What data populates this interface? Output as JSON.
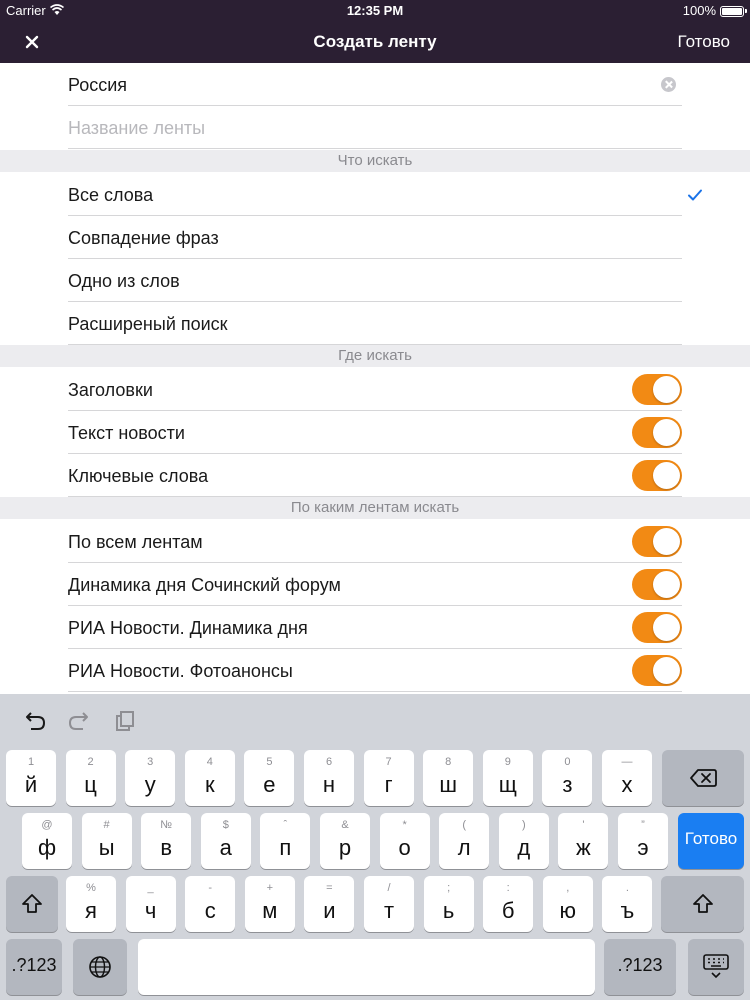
{
  "status_bar": {
    "carrier": "Carrier",
    "time": "12:35 PM",
    "battery": "100%"
  },
  "nav": {
    "close_label": "×",
    "title": "Создать ленту",
    "done_label": "Готово"
  },
  "form": {
    "search_value": "Россия",
    "name_placeholder": "Название ленты"
  },
  "sections": {
    "what": {
      "header": "Что искать",
      "items": [
        "Все слова",
        "Совпадение фраз",
        "Одно из слов",
        "Расширеный поиск"
      ],
      "selected": "Все слова"
    },
    "where": {
      "header": "Где искать",
      "items": [
        {
          "label": "Заголовки",
          "on": true
        },
        {
          "label": "Текст новости",
          "on": true
        },
        {
          "label": "Ключевые слова",
          "on": true
        }
      ]
    },
    "feeds": {
      "header": "По каким лентам искать",
      "items": [
        {
          "label": "По всем лентам",
          "on": true
        },
        {
          "label": "Динамика дня Сочинский форум",
          "on": true
        },
        {
          "label": "РИА Новости. Динамика дня",
          "on": true
        },
        {
          "label": "РИА Новости. Фотоанонсы",
          "on": true
        }
      ]
    }
  },
  "colors": {
    "nav_bg": "#2b1f33",
    "toggle_on": "#f28a14",
    "accent": "#1a73e8",
    "go_key": "#1a7ef2"
  },
  "keyboard": {
    "toolbar": [
      "undo-icon",
      "redo-icon",
      "paste-icon"
    ],
    "row1": [
      {
        "hint": "1",
        "key": "й"
      },
      {
        "hint": "2",
        "key": "ц"
      },
      {
        "hint": "3",
        "key": "у"
      },
      {
        "hint": "4",
        "key": "к"
      },
      {
        "hint": "5",
        "key": "е"
      },
      {
        "hint": "6",
        "key": "н"
      },
      {
        "hint": "7",
        "key": "г"
      },
      {
        "hint": "8",
        "key": "ш"
      },
      {
        "hint": "9",
        "key": "щ"
      },
      {
        "hint": "0",
        "key": "з"
      },
      {
        "hint": "—",
        "key": "х"
      }
    ],
    "row2": [
      {
        "hint": "@",
        "key": "ф"
      },
      {
        "hint": "#",
        "key": "ы"
      },
      {
        "hint": "№",
        "key": "в"
      },
      {
        "hint": "$",
        "key": "а"
      },
      {
        "hint": "ˆ",
        "key": "п"
      },
      {
        "hint": "&",
        "key": "р"
      },
      {
        "hint": "*",
        "key": "о"
      },
      {
        "hint": "(",
        "key": "л"
      },
      {
        "hint": ")",
        "key": "д"
      },
      {
        "hint": "'",
        "key": "ж"
      },
      {
        "hint": "”",
        "key": "э"
      }
    ],
    "row3": [
      {
        "hint": "%",
        "key": "я"
      },
      {
        "hint": "_",
        "key": "ч"
      },
      {
        "hint": "-",
        "key": "с"
      },
      {
        "hint": "+",
        "key": "м"
      },
      {
        "hint": "=",
        "key": "и"
      },
      {
        "hint": "/",
        "key": "т"
      },
      {
        "hint": ";",
        "key": "ь"
      },
      {
        "hint": ":",
        "key": "б"
      },
      {
        "hint": ",",
        "key": "ю"
      },
      {
        "hint": ".",
        "key": "ъ"
      }
    ],
    "go_label": "Готово",
    "numbers_label": ".?123"
  }
}
